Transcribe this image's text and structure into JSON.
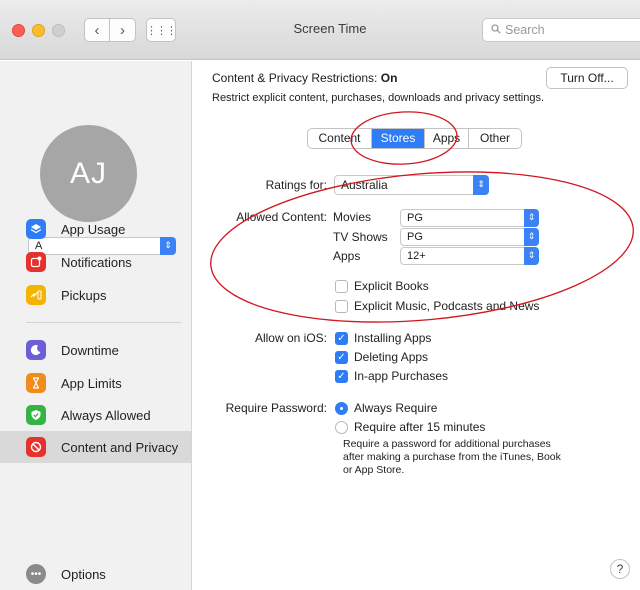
{
  "window": {
    "title": "Screen Time"
  },
  "toolbar": {
    "back_glyph": "‹",
    "forward_glyph": "›",
    "grid_glyph": "⋮⋮⋮",
    "search_placeholder": "Search"
  },
  "user": {
    "initials": "AJ",
    "selected_name": "A"
  },
  "sidebar": {
    "items": [
      {
        "label": "App Usage",
        "icon": "layers-icon",
        "color": "#2f7cf6"
      },
      {
        "label": "Notifications",
        "icon": "notification-badge-icon",
        "color": "#e5322d"
      },
      {
        "label": "Pickups",
        "icon": "pickup-icon",
        "color": "#f5b400"
      },
      {
        "label": "Downtime",
        "icon": "moon-icon",
        "color": "#6b5fd6"
      },
      {
        "label": "App Limits",
        "icon": "hourglass-icon",
        "color": "#f08c1a"
      },
      {
        "label": "Always Allowed",
        "icon": "checkmark-shield-icon",
        "color": "#34b443"
      },
      {
        "label": "Content and Privacy",
        "icon": "no-entry-icon",
        "color": "#e5322d"
      }
    ],
    "selected_index": 6,
    "options_label": "Options"
  },
  "restrictions": {
    "title_prefix": "Content & Privacy Restrictions:",
    "status": "On",
    "subtitle": "Restrict explicit content, purchases, downloads and privacy settings.",
    "turn_off_label": "Turn Off..."
  },
  "tabs": {
    "items": [
      "Content",
      "Stores",
      "Apps",
      "Other"
    ],
    "active": "Stores"
  },
  "stores": {
    "ratings_label": "Ratings for:",
    "ratings_value": "Australia",
    "allowed_label": "Allowed Content:",
    "allowed": [
      {
        "label": "Movies",
        "value": "PG"
      },
      {
        "label": "TV Shows",
        "value": "PG"
      },
      {
        "label": "Apps",
        "value": "12+"
      }
    ],
    "explicit_books": {
      "label": "Explicit Books",
      "checked": false
    },
    "explicit_music": {
      "label": "Explicit Music, Podcasts and News",
      "checked": false
    },
    "allow_ios_label": "Allow on iOS:",
    "ios": [
      {
        "label": "Installing Apps",
        "checked": true
      },
      {
        "label": "Deleting Apps",
        "checked": true
      },
      {
        "label": "In-app Purchases",
        "checked": true
      }
    ],
    "require_password_label": "Require Password:",
    "password_options": [
      {
        "label": "Always Require",
        "selected": true
      },
      {
        "label": "Require after 15 minutes",
        "selected": false
      }
    ],
    "password_note": "Require a password for additional purchases after making a purchase from the iTunes, Book or App Store."
  },
  "help_label": "?",
  "colors": {
    "accent": "#2e7cf6",
    "annotation": "#d0161e"
  }
}
